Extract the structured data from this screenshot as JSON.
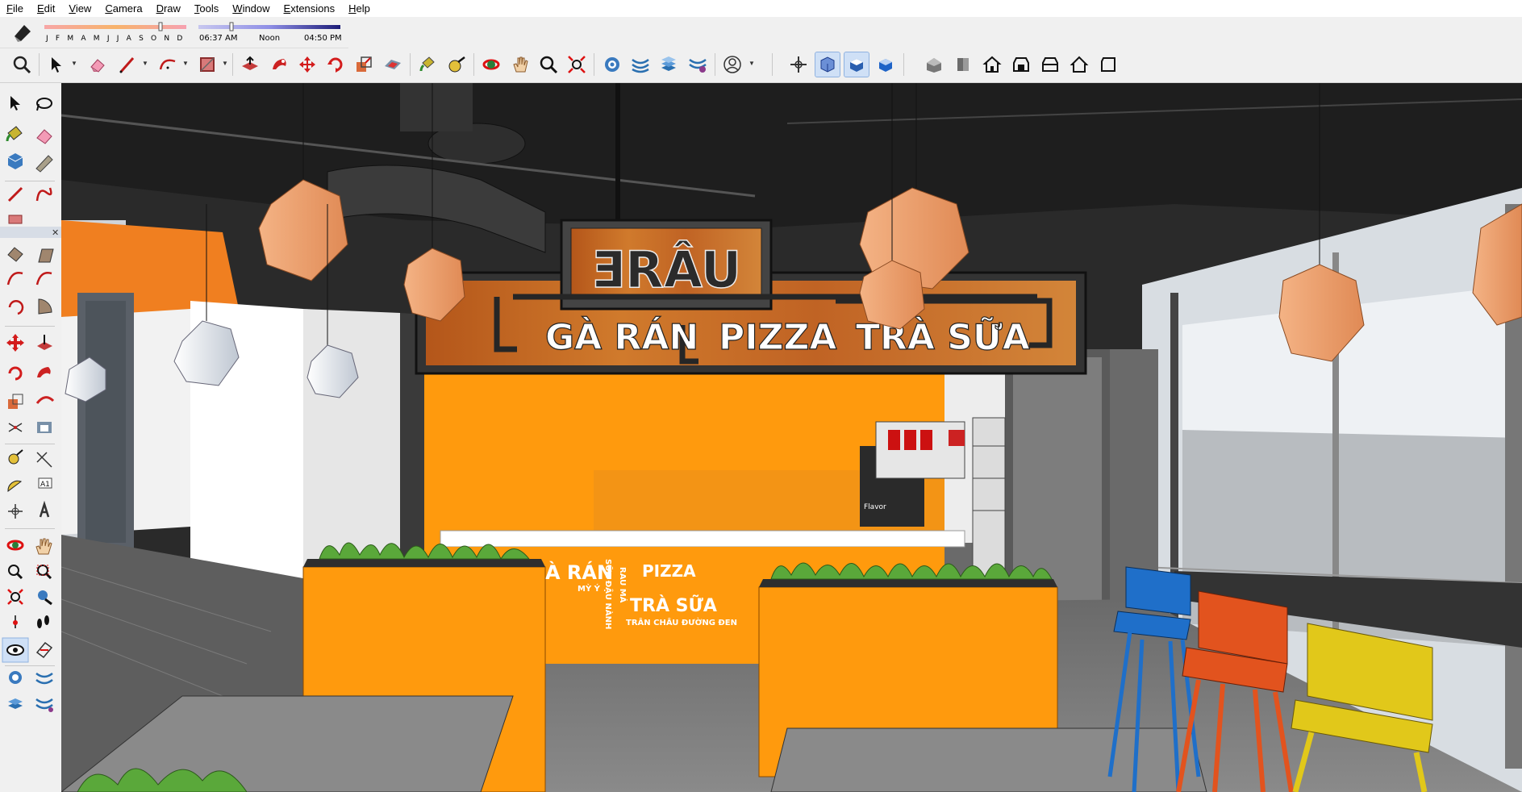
{
  "menu": [
    "File",
    "Edit",
    "View",
    "Camera",
    "Draw",
    "Tools",
    "Window",
    "Extensions",
    "Help"
  ],
  "shadows": {
    "months": "J F M A M J J A S O N D",
    "time_start": "06:37 AM",
    "time_mid": "Noon",
    "time_end": "04:50 PM"
  },
  "toolbar": {
    "icons": [
      "zoom-icon",
      "select-icon",
      "eraser-icon",
      "pencil-icon",
      "arc-icon",
      "rectangle-icon",
      "push-pull-icon",
      "follow-me-icon",
      "move-icon",
      "rotate-icon",
      "scale-icon",
      "offset-icon",
      "paint-bucket-icon",
      "tape-measure-icon",
      "orbit-icon",
      "pan-icon",
      "zoom-window-icon",
      "zoom-extents-icon",
      "sandbox-icon",
      "sandbox-grid-icon",
      "sandbox-stamp-icon",
      "sandbox-drape-icon",
      "user-account-icon",
      "axes-icon",
      "xray-style-icon",
      "hidden-line-style-icon",
      "shaded-style-icon",
      "iso-view-icon",
      "top-view-icon",
      "front-view-icon",
      "right-view-icon",
      "back-view-icon",
      "left-view-icon",
      "bottom-view-icon"
    ]
  },
  "scene": {
    "brand_sign": "ƎRÂU",
    "sign_line_1": "GÀ RÁN",
    "sign_line_2": "PIZZA",
    "sign_line_3": "TRÀ SỮA",
    "counter_text_1": "À RÁN",
    "counter_text_2": "PIZZA",
    "counter_text_3": "TRÀ SỮA",
    "counter_text_small_1": "MỲ Ý",
    "counter_text_small_2": "SỮA ĐẬU NÀNH",
    "counter_text_small_3": "RAU MÁ",
    "counter_text_small_4": "TRÂN CHÂU ĐƯỜNG ĐEN",
    "machine_label": "Flavor"
  },
  "colors": {
    "orange": "#ff9a0d",
    "wood": "#c8691c",
    "lamp": "#f2a775",
    "chair_blue": "#1f6fc9",
    "chair_orange": "#e2531e",
    "chair_yellow": "#e1c81a"
  }
}
